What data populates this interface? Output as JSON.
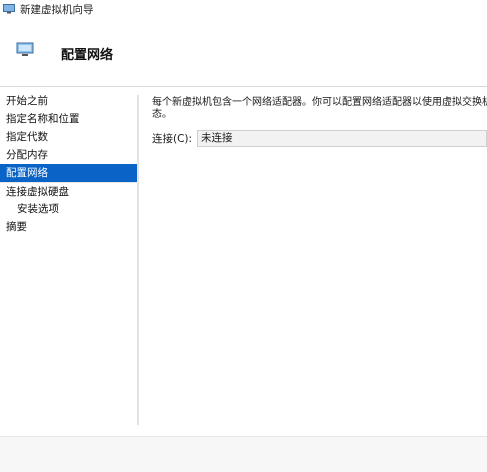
{
  "window": {
    "title": "新建虚拟机向导"
  },
  "header": {
    "title": "配置网络"
  },
  "nav": {
    "items": [
      {
        "label": "开始之前"
      },
      {
        "label": "指定名称和位置"
      },
      {
        "label": "指定代数"
      },
      {
        "label": "分配内存"
      },
      {
        "label": "配置网络"
      },
      {
        "label": "连接虚拟硬盘"
      },
      {
        "label": "安装选项"
      },
      {
        "label": "摘要"
      }
    ]
  },
  "content": {
    "description_line1": "每个新虚拟机包含一个网络适配器。你可以配置网络适配器以使用虚拟交换机",
    "description_line2": "态。",
    "connection_label": "连接(C):",
    "connection_value": "未连接"
  },
  "colors": {
    "selected": "#0a64c8"
  }
}
